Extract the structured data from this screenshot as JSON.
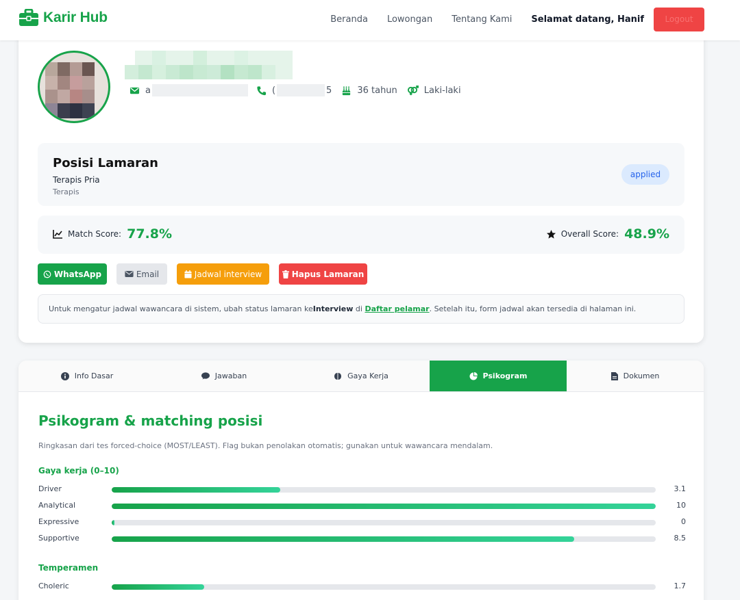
{
  "app": {
    "brand": "Karir Hub"
  },
  "nav": {
    "links": [
      "Beranda",
      "Lowongan",
      "Tentang Kami"
    ],
    "welcome": "Selamat datang, Hanif",
    "logout": "Logout"
  },
  "profile": {
    "email_prefix": "a",
    "phone_prefix": "(",
    "phone_suffix": "5",
    "age": "36 tahun",
    "gender": "Laki-laki"
  },
  "position": {
    "heading": "Posisi Lamaran",
    "job": "Terapis Pria",
    "department": "Terapis",
    "status": "applied"
  },
  "scores": {
    "match_label": "Match Score:",
    "match_value": "77.8%",
    "overall_label": "Overall Score:",
    "overall_value": "48.9%"
  },
  "actions": {
    "whatsapp": "WhatsApp",
    "email": "Email",
    "schedule": "Jadwal interview",
    "delete": "Hapus Lamaran"
  },
  "note": {
    "part1": "Untuk mengatur jadwal wawancara di sistem, ubah status lamaran ke ",
    "bold": "Interview",
    "part2": " di ",
    "link": "Daftar pelamar",
    "part3": ". Setelah itu, form jadwal akan tersedia di halaman ini."
  },
  "tabs": [
    {
      "label": "Info Dasar",
      "icon": "info-icon",
      "active": false
    },
    {
      "label": "Jawaban",
      "icon": "comment-icon",
      "active": false
    },
    {
      "label": "Gaya Kerja",
      "icon": "brain-icon",
      "active": false
    },
    {
      "label": "Psikogram",
      "icon": "pie-chart-icon",
      "active": true
    },
    {
      "label": "Dokumen",
      "icon": "file-icon",
      "active": false
    }
  ],
  "psikogram": {
    "title": "Psikogram & matching posisi",
    "subtitle": "Ringkasan dari tes forced-choice (MOST/LEAST). Flag bukan penolakan otomatis; gunakan untuk wawancara mendalam.",
    "work_style_heading": "Gaya kerja (0–10)",
    "work_style": [
      {
        "label": "Driver",
        "value": 3.1,
        "display": "3.1"
      },
      {
        "label": "Analytical",
        "value": 10,
        "display": "10"
      },
      {
        "label": "Expressive",
        "value": 0,
        "display": "0"
      },
      {
        "label": "Supportive",
        "value": 8.5,
        "display": "8.5"
      }
    ],
    "temperament_heading": "Temperamen",
    "temperament": [
      {
        "label": "Choleric",
        "value": 1.7,
        "display": "1.7"
      }
    ]
  },
  "colors": {
    "brand": "#17a34a",
    "danger": "#ef4444",
    "warning": "#f59e0b",
    "badge_bg": "#dbeafe",
    "badge_text": "#2563eb"
  }
}
